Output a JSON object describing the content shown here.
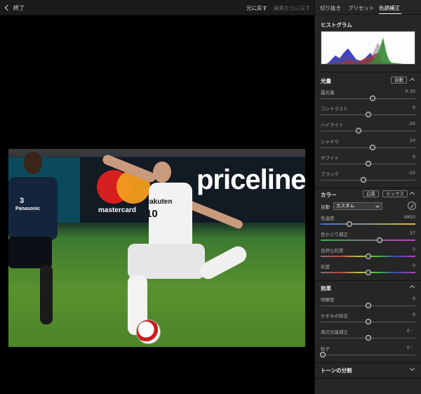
{
  "topbar": {
    "back_label": "終了",
    "revert_label": "元に戻す",
    "undo_revert_label": "編集を元に戻す"
  },
  "panel": {
    "tabs": [
      {
        "label": "切り抜き",
        "active": false
      },
      {
        "label": "プリセット",
        "active": false
      },
      {
        "label": "色調補正",
        "active": true
      }
    ],
    "histogram": {
      "title": "ヒストグラム"
    },
    "light": {
      "title": "光量",
      "auto_label": "自動",
      "sliders": [
        {
          "label": "露光量",
          "value": "0.30",
          "position": 0.55
        },
        {
          "label": "コントラスト",
          "value": "0",
          "position": 0.5
        },
        {
          "label": "ハイライト",
          "value": "-20",
          "position": 0.4
        },
        {
          "label": "シャドウ",
          "value": "10",
          "position": 0.55
        },
        {
          "label": "ホワイト",
          "value": "0",
          "position": 0.5
        },
        {
          "label": "ブラック",
          "value": "-10",
          "position": 0.45
        }
      ]
    },
    "color": {
      "title": "カラー",
      "white_label": "白黒",
      "mix_label": "ミックス",
      "wb_auto_label": "自動",
      "wb_preset": "カスタム",
      "sliders": [
        {
          "label": "色温度",
          "value": "4850",
          "position": 0.3
        },
        {
          "label": "色かぶり補正",
          "value": "37",
          "position": 0.62
        },
        {
          "label": "自然な彩度",
          "value": "0",
          "position": 0.5
        },
        {
          "label": "彩度",
          "value": "0",
          "position": 0.5
        }
      ]
    },
    "effects": {
      "title": "効果",
      "sliders": [
        {
          "label": "明瞭度",
          "value": "0",
          "position": 0.5
        },
        {
          "label": "かすみの除去",
          "value": "0",
          "position": 0.5
        },
        {
          "label": "周辺光量補正",
          "value": "0",
          "position": 0.5
        },
        {
          "label": "粒子",
          "value": "0",
          "position": 0.02
        }
      ]
    },
    "split_toning": {
      "title": "トーンの分割"
    }
  },
  "photo": {
    "board_left_text": "",
    "board_main_text": "priceline",
    "mastercard_text": "mastercard",
    "main_player_number": "10",
    "main_player_sponsor": "Rakuten",
    "left_player_number": "3",
    "left_player_sponsor": "Panasonic"
  },
  "colors": {
    "panel_bg": "#262626",
    "topbar_bg": "#1b1b1b",
    "canvas_bg": "#000000"
  }
}
